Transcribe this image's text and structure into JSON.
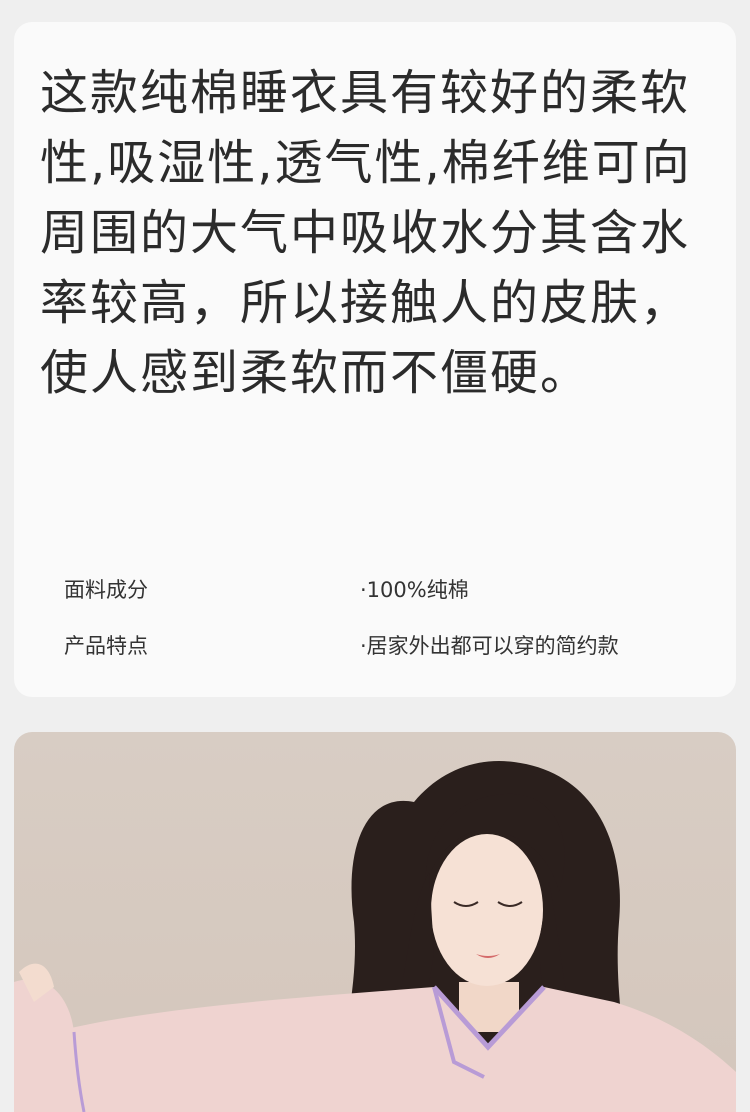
{
  "description": "这款纯棉睡衣具有较好的柔软性,吸湿性,透气性,棉纤维可向周围的大气中吸收水分其含水率较高，所以接触人的皮肤，使人感到柔软而不僵硬。",
  "specs": [
    {
      "label": "面料成分",
      "value": "·100%纯棉"
    },
    {
      "label": "产品特点",
      "value": "·居家外出都可以穿的简约款"
    }
  ],
  "colors": {
    "page_bg": "#efefef",
    "card_bg": "#fafafa",
    "pajama_pink": "#efd3d0",
    "piping_lilac": "#b89bd6"
  }
}
